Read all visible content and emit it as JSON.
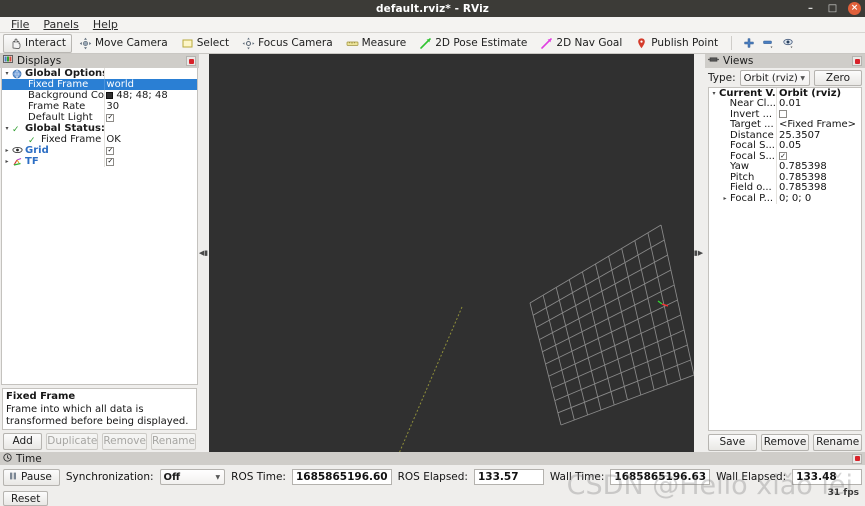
{
  "window": {
    "title": "default.rviz* - RViz",
    "minimize": "–",
    "maximize": "□",
    "close": "×"
  },
  "menubar": {
    "items": [
      {
        "label": "File"
      },
      {
        "label": "Panels"
      },
      {
        "label": "Help"
      }
    ]
  },
  "toolbar": {
    "items": [
      {
        "label": "Interact",
        "icon": "hand-icon",
        "active": true
      },
      {
        "label": "Move Camera",
        "icon": "move-camera-icon",
        "active": false
      },
      {
        "label": "Select",
        "icon": "select-rect-icon",
        "active": false
      },
      {
        "label": "Focus Camera",
        "icon": "focus-camera-icon",
        "active": false
      },
      {
        "label": "Measure",
        "icon": "measure-icon",
        "active": false
      },
      {
        "label": "2D Pose Estimate",
        "icon": "pose-estimate-arrow-icon",
        "active": false
      },
      {
        "label": "2D Nav Goal",
        "icon": "nav-goal-arrow-icon",
        "active": false
      },
      {
        "label": "Publish Point",
        "icon": "publish-point-pin-icon",
        "active": false
      }
    ],
    "extra_icons": [
      {
        "name": "plus-icon"
      },
      {
        "name": "minus-dropdown-icon"
      },
      {
        "name": "eye-dropdown-icon"
      }
    ]
  },
  "displays": {
    "title": "Displays",
    "title_icon": "displays-panel-icon",
    "close_icon": "close-icon",
    "rows": [
      {
        "indent": 0,
        "arrow": "▾",
        "icon": "globe-icon",
        "label": "Global Options",
        "label_style": "bold",
        "value": "",
        "value_type": "text",
        "selected": false
      },
      {
        "indent": 1,
        "arrow": "",
        "icon": "",
        "label": "Fixed Frame",
        "label_style": "",
        "value": "world",
        "value_type": "text",
        "selected": true
      },
      {
        "indent": 1,
        "arrow": "",
        "icon": "",
        "label": "Background Color",
        "label_style": "",
        "value": "48; 48; 48",
        "value_type": "color",
        "selected": false
      },
      {
        "indent": 1,
        "arrow": "",
        "icon": "",
        "label": "Frame Rate",
        "label_style": "",
        "value": "30",
        "value_type": "text",
        "selected": false
      },
      {
        "indent": 1,
        "arrow": "",
        "icon": "",
        "label": "Default Light",
        "label_style": "",
        "value": "",
        "value_type": "checkbox",
        "selected": false
      },
      {
        "indent": 0,
        "arrow": "▾",
        "icon": "check-green",
        "label": "Global Status: Ok",
        "label_style": "bold",
        "value": "",
        "value_type": "text",
        "selected": false
      },
      {
        "indent": 1,
        "arrow": "",
        "icon": "check-green",
        "label": "Fixed Frame",
        "label_style": "",
        "value": "OK",
        "value_type": "text",
        "selected": false
      },
      {
        "indent": 0,
        "arrow": "▸",
        "icon": "eye-icon",
        "label": "Grid",
        "label_style": "link",
        "value": "",
        "value_type": "checkbox",
        "selected": false
      },
      {
        "indent": 0,
        "arrow": "▸",
        "icon": "tf-axes-icon",
        "label": "TF",
        "label_style": "link",
        "value": "",
        "value_type": "checkbox",
        "selected": false
      }
    ],
    "description": {
      "heading": "Fixed Frame",
      "text": "Frame into which all data is transformed before being displayed."
    },
    "buttons": [
      {
        "label": "Add",
        "enabled": true
      },
      {
        "label": "Duplicate",
        "enabled": false
      },
      {
        "label": "Remove",
        "enabled": false
      },
      {
        "label": "Rename",
        "enabled": false
      }
    ]
  },
  "views": {
    "title": "Views",
    "title_icon": "views-panel-icon",
    "close_icon": "close-icon",
    "type_label": "Type:",
    "type_value": "Orbit (rviz)",
    "zero_button": "Zero",
    "rows": [
      {
        "indent": 0,
        "arrow": "▾",
        "name": "Current V...",
        "value": "Orbit (rviz)",
        "value_type": "text",
        "header": true
      },
      {
        "indent": 1,
        "arrow": "",
        "name": "Near Cl...",
        "value": "0.01",
        "value_type": "text",
        "header": false
      },
      {
        "indent": 1,
        "arrow": "",
        "name": "Invert ...",
        "value": "",
        "value_type": "checkbox_unchecked",
        "header": false
      },
      {
        "indent": 1,
        "arrow": "",
        "name": "Target ...",
        "value": "<Fixed Frame>",
        "value_type": "text",
        "header": false
      },
      {
        "indent": 1,
        "arrow": "",
        "name": "Distance",
        "value": "25.3507",
        "value_type": "text",
        "header": false
      },
      {
        "indent": 1,
        "arrow": "",
        "name": "Focal S...",
        "value": "0.05",
        "value_type": "text",
        "header": false
      },
      {
        "indent": 1,
        "arrow": "",
        "name": "Focal S...",
        "value": "",
        "value_type": "checkbox",
        "header": false
      },
      {
        "indent": 1,
        "arrow": "",
        "name": "Yaw",
        "value": "0.785398",
        "value_type": "text",
        "header": false
      },
      {
        "indent": 1,
        "arrow": "",
        "name": "Pitch",
        "value": "0.785398",
        "value_type": "text",
        "header": false
      },
      {
        "indent": 1,
        "arrow": "",
        "name": "Field o...",
        "value": "0.785398",
        "value_type": "text",
        "header": false
      },
      {
        "indent": 1,
        "arrow": "▸",
        "name": "Focal P...",
        "value": "0; 0; 0",
        "value_type": "text",
        "header": false
      }
    ],
    "buttons": [
      {
        "label": "Save"
      },
      {
        "label": "Remove"
      },
      {
        "label": "Rename"
      }
    ]
  },
  "time": {
    "title": "Time",
    "title_icon": "clock-icon",
    "close_icon": "close-icon",
    "pause_label": "Pause",
    "pause_icon": "pause-icon",
    "sync_label": "Synchronization:",
    "sync_value": "Off",
    "ros_time_label": "ROS Time:",
    "ros_time_value": "1685865196.60",
    "ros_elapsed_label": "ROS Elapsed:",
    "ros_elapsed_value": "133.57",
    "wall_time_label": "Wall Time:",
    "wall_time_value": "1685865196.63",
    "wall_elapsed_label": "Wall Elapsed:",
    "wall_elapsed_value": "133.48",
    "reset_label": "Reset",
    "fps": "31 fps",
    "watermark": "CSDN @Hello xiǎo lěi"
  },
  "viewport": {
    "background_color": "#303030",
    "grid_color": "#9a9a9a",
    "grid_cells": 10,
    "tf_line_color": "#9a9a3c",
    "axis_x_color": "#ff2a2a",
    "axis_y_color": "#2aff2a",
    "axis_z_color": "#2a6aff"
  }
}
